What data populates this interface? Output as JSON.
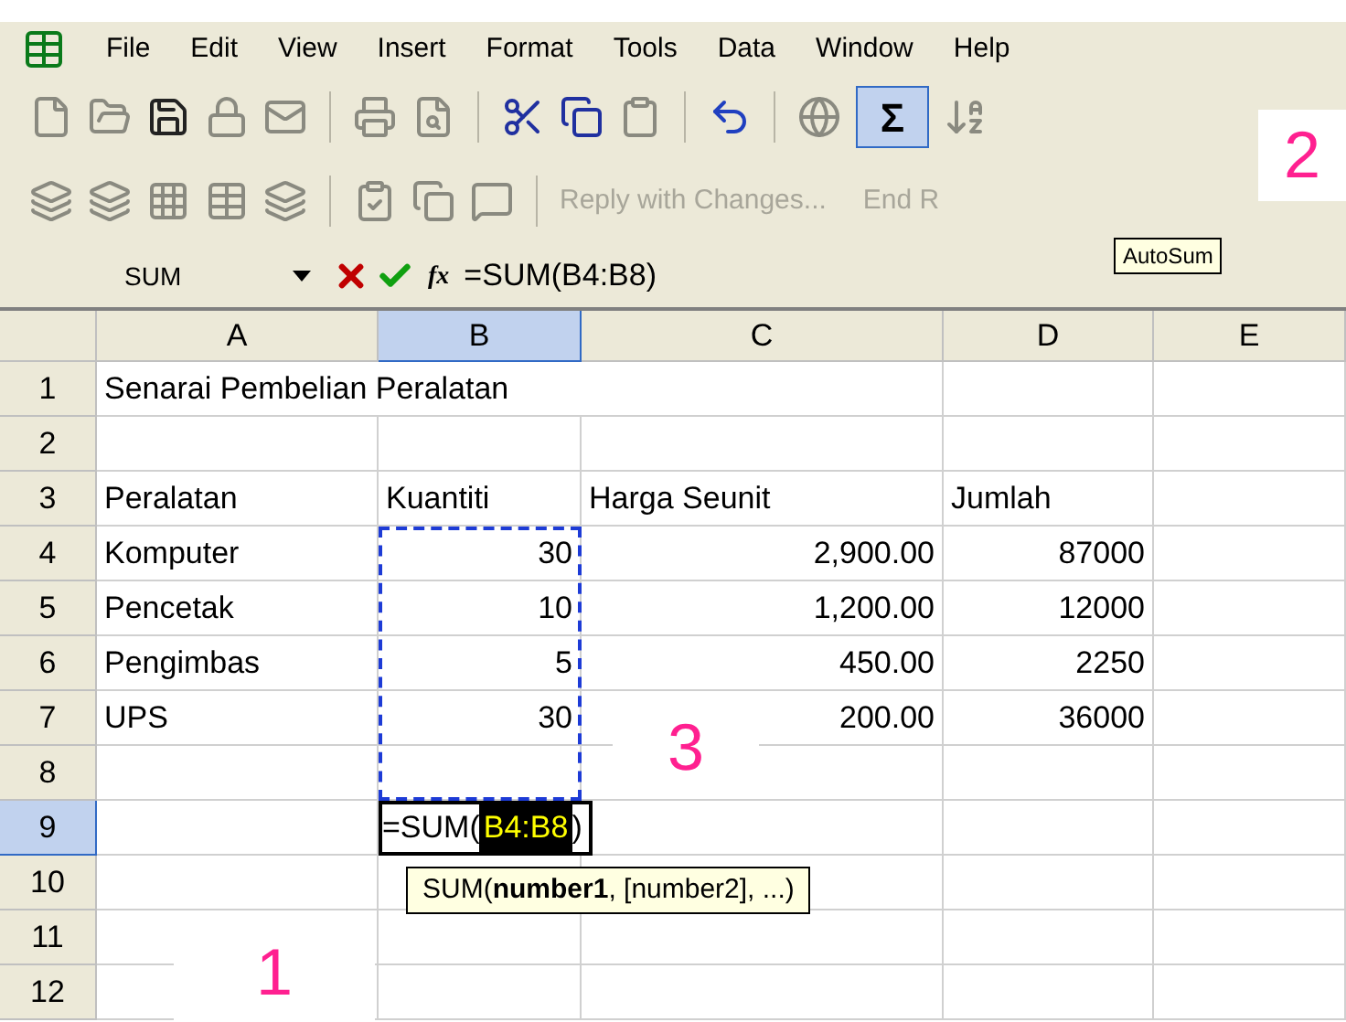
{
  "menu": [
    "File",
    "Edit",
    "View",
    "Insert",
    "Format",
    "Tools",
    "Data",
    "Window",
    "Help"
  ],
  "standard_toolbar": {
    "autosum_button": {
      "label": "Σ",
      "highlighted": true
    }
  },
  "reviewing_toolbar": {
    "reply_button": "Reply with Changes...",
    "end_review_button": "End R"
  },
  "tooltip": "AutoSum",
  "formula_bar": {
    "name_box": "SUM",
    "function_button": "fx",
    "formula": "=SUM(B4:B8)"
  },
  "columns": [
    {
      "label": "A",
      "selected": false
    },
    {
      "label": "B",
      "selected": true
    },
    {
      "label": "C",
      "selected": false
    },
    {
      "label": "D",
      "selected": false
    },
    {
      "label": "E",
      "selected": false
    }
  ],
  "rows": [
    {
      "label": "1",
      "selected": false,
      "cells": {
        "A": "Senarai Pembelian Peralatan"
      }
    },
    {
      "label": "2",
      "selected": false,
      "cells": {}
    },
    {
      "label": "3",
      "selected": false,
      "cells": {
        "A": "Peralatan",
        "B": "Kuantiti",
        "C": "Harga Seunit",
        "D": "Jumlah"
      }
    },
    {
      "label": "4",
      "selected": false,
      "cells": {
        "A": "Komputer",
        "B": "30",
        "C": "2,900.00",
        "D": "87000"
      }
    },
    {
      "label": "5",
      "selected": false,
      "cells": {
        "A": "Pencetak",
        "B": "10",
        "C": "1,200.00",
        "D": "12000"
      }
    },
    {
      "label": "6",
      "selected": false,
      "cells": {
        "A": "Pengimbas",
        "B": "5",
        "C": "450.00",
        "D": "2250"
      }
    },
    {
      "label": "7",
      "selected": false,
      "cells": {
        "A": "UPS",
        "B": "30",
        "C": "200.00",
        "D": "36000"
      }
    },
    {
      "label": "8",
      "selected": false,
      "cells": {}
    },
    {
      "label": "9",
      "selected": true,
      "cells": {}
    },
    {
      "label": "10",
      "selected": false,
      "cells": {}
    },
    {
      "label": "11",
      "selected": false,
      "cells": {}
    },
    {
      "label": "12",
      "selected": false,
      "cells": {}
    }
  ],
  "active_cell": {
    "prefix": "=SUM(",
    "reference": "B4:B8",
    "suffix": ")"
  },
  "function_tip": "SUM(**number1**, [number2], ...)",
  "annotations": [
    "1",
    "2",
    "3"
  ]
}
